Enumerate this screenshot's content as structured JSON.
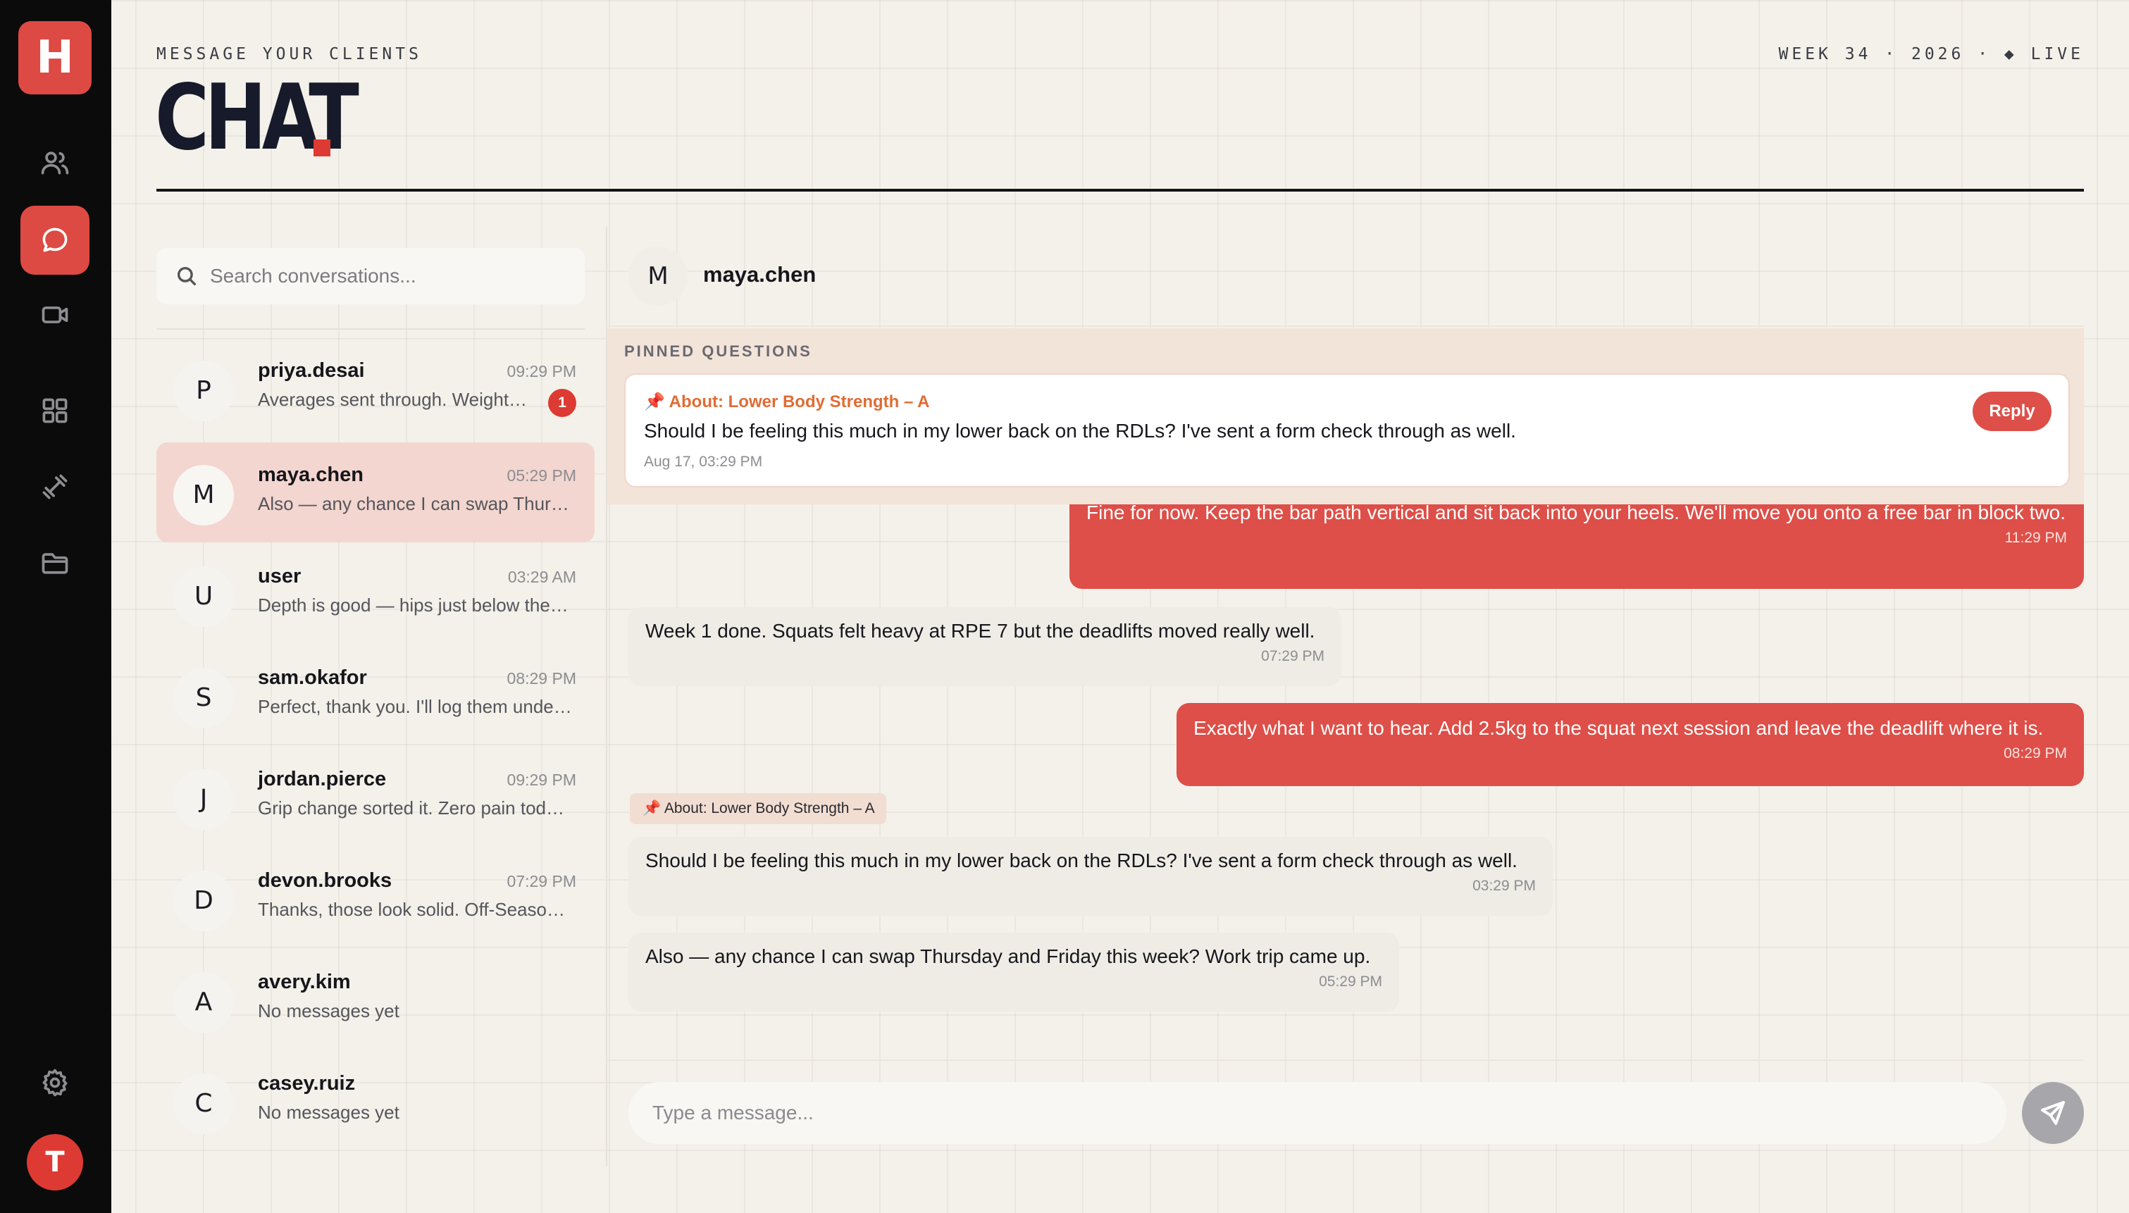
{
  "app": {
    "logo_letter": "H",
    "user_initial": "T"
  },
  "nav": [
    {
      "name": "clients",
      "icon": "users-icon"
    },
    {
      "name": "chat",
      "icon": "chat-bubble-icon",
      "active": true
    },
    {
      "name": "video",
      "icon": "video-icon"
    },
    {
      "name": "dashboard",
      "icon": "grid-icon"
    },
    {
      "name": "workouts",
      "icon": "dumbbell-icon"
    },
    {
      "name": "files",
      "icon": "folder-icon"
    },
    {
      "name": "settings",
      "icon": "gear-icon"
    }
  ],
  "header": {
    "kicker": "MESSAGE YOUR CLIENTS",
    "title": "CHAT",
    "status": "WEEK 34 · 2026 · ◆ LIVE"
  },
  "search": {
    "placeholder": "Search conversations..."
  },
  "conversations": [
    {
      "initial": "P",
      "name": "priya.desai",
      "time": "09:29 PM",
      "preview": "Averages sent through. Weight is down a little this week.",
      "unread": "1"
    },
    {
      "initial": "M",
      "name": "maya.chen",
      "time": "05:29 PM",
      "preview": "Also — any chance I can swap Thursday and Friday this week?",
      "active": true
    },
    {
      "initial": "U",
      "name": "user",
      "time": "03:29 AM",
      "preview": "Depth is good — hips just below the knee on every rep."
    },
    {
      "initial": "S",
      "name": "sam.okafor",
      "time": "08:29 PM",
      "preview": "Perfect, thank you. I'll log them under the new block."
    },
    {
      "initial": "J",
      "name": "jordan.pierce",
      "time": "09:29 PM",
      "preview": "Grip change sorted it. Zero pain today on the bench."
    },
    {
      "initial": "D",
      "name": "devon.brooks",
      "time": "07:29 PM",
      "preview": "Thanks, those look solid. Off-Season block starts Monday."
    },
    {
      "initial": "A",
      "name": "avery.kim",
      "time": "",
      "preview": "No messages yet"
    },
    {
      "initial": "C",
      "name": "casey.ruiz",
      "time": "",
      "preview": "No messages yet"
    }
  ],
  "chat": {
    "contact_initial": "M",
    "contact_name": "maya.chen",
    "pinned_label": "PINNED QUESTIONS",
    "pinned": {
      "about": "📌 About: Lower Body Strength – A",
      "question": "Should I be feeling this much in my lower back on the RDLs? I've sent a form check through as well.",
      "timestamp": "Aug 17, 03:29 PM",
      "reply_label": "Reply"
    },
    "messages": [
      {
        "dir": "out",
        "text": "Fine for now. Keep the bar path vertical and sit back into your heels. We'll move you onto a free bar in block two.",
        "time": "11:29 PM"
      },
      {
        "dir": "in",
        "text": "Week 1 done. Squats felt heavy at RPE 7 but the deadlifts moved really well.",
        "time": "07:29 PM"
      },
      {
        "dir": "out",
        "text": "Exactly what I want to hear. Add 2.5kg to the squat next session and leave the deadlift where it is.",
        "time": "08:29 PM"
      },
      {
        "dir": "in",
        "tag": "📌 About: Lower Body Strength – A",
        "text": "Should I be feeling this much in my lower back on the RDLs? I've sent a form check through as well.",
        "time": "03:29 PM"
      },
      {
        "dir": "in",
        "text": "Also — any chance I can swap Thursday and Friday this week? Work trip came up.",
        "time": "05:29 PM"
      }
    ],
    "composer_placeholder": "Type a message..."
  },
  "colors": {
    "accent": "#dd4f48",
    "rail": "#0b0b0b",
    "background": "#f4f1ea"
  }
}
